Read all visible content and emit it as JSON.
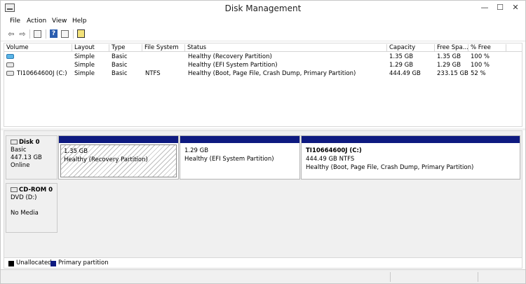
{
  "window": {
    "title": "Disk Management",
    "controls": {
      "minimize": "—",
      "maximize": "☐",
      "close": "✕"
    }
  },
  "menu": [
    "File",
    "Action",
    "View",
    "Help"
  ],
  "toolbar": {
    "back": "⇦",
    "forward": "⇨",
    "help_glyph": "?"
  },
  "volume_list": {
    "columns": [
      "Volume",
      "Layout",
      "Type",
      "File System",
      "Status",
      "Capacity",
      "Free Spa...",
      "% Free"
    ],
    "rows": [
      {
        "icon": "blue-drive-icon",
        "volume": "",
        "layout": "Simple",
        "type": "Basic",
        "fs": "",
        "status": "Healthy (Recovery Partition)",
        "capacity": "1.35 GB",
        "free": "1.35 GB",
        "pct": "100 %"
      },
      {
        "icon": "drive-icon",
        "volume": "",
        "layout": "Simple",
        "type": "Basic",
        "fs": "",
        "status": "Healthy (EFI System Partition)",
        "capacity": "1.29 GB",
        "free": "1.29 GB",
        "pct": "100 %"
      },
      {
        "icon": "drive-icon",
        "volume": "TI10664600J (C:)",
        "layout": "Simple",
        "type": "Basic",
        "fs": "NTFS",
        "status": "Healthy (Boot, Page File, Crash Dump, Primary Partition)",
        "capacity": "444.49 GB",
        "free": "233.15 GB",
        "pct": "52 %"
      }
    ]
  },
  "disks": [
    {
      "name": "Disk 0",
      "type": "Basic",
      "size": "447.13 GB",
      "state": "Online",
      "partitions": [
        {
          "title": "",
          "line1": "1.35 GB",
          "line2": "Healthy (Recovery Partition)"
        },
        {
          "title": "",
          "line1": "1.29 GB",
          "line2": "Healthy (EFI System Partition)"
        },
        {
          "title": "TI10664600J (C:)",
          "line1": "444.49 GB NTFS",
          "line2": "Healthy (Boot, Page File, Crash Dump, Primary Partition)"
        }
      ]
    },
    {
      "name": "CD-ROM 0",
      "type": "DVD (D:)",
      "size": "",
      "state": "No Media"
    }
  ],
  "legend": [
    {
      "label": "Unallocated",
      "color": "#000000"
    },
    {
      "label": "Primary partition",
      "color": "#0e1a80"
    }
  ]
}
